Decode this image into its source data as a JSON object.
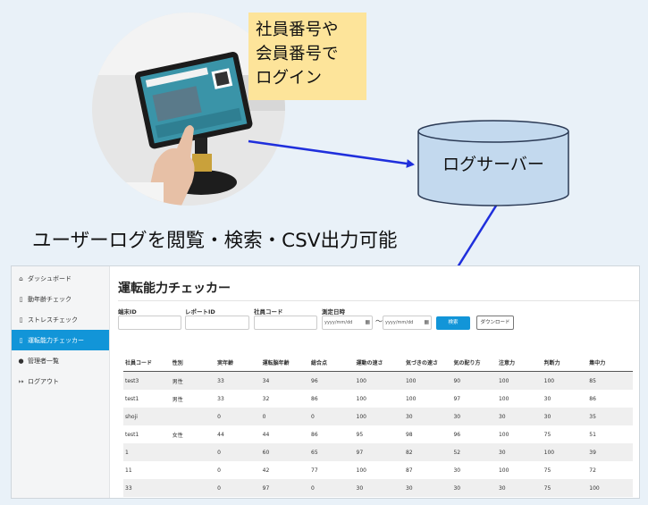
{
  "callout": {
    "lines": [
      "社員番号や",
      "会員番号で",
      "ログイン"
    ]
  },
  "server": {
    "label": "ログサーバー"
  },
  "headline": "ユーザーログを閲覧・検索・CSV出力可能",
  "app": {
    "sidebar": {
      "items": [
        {
          "icon": "home-icon",
          "label": "ダッシュボード",
          "active": false
        },
        {
          "icon": "document-icon",
          "label": "動年齢チェック",
          "active": false
        },
        {
          "icon": "document-icon",
          "label": "ストレスチェック",
          "active": false
        },
        {
          "icon": "document-icon",
          "label": "運転能力チェッカー",
          "active": true
        },
        {
          "icon": "user-icon",
          "label": "管理者一覧",
          "active": false
        },
        {
          "icon": "logout-icon",
          "label": "ログアウト",
          "active": false
        }
      ]
    },
    "page_title": "運転能力チェッカー",
    "filters": {
      "device_id_label": "端末ID",
      "report_id_label": "レポートID",
      "employee_code_label": "社員コード",
      "date_label": "測定日時",
      "date_from_placeholder": "yyyy/mm/dd",
      "date_to_placeholder": "yyyy/mm/dd",
      "tilde": "〜",
      "search_button": "検索",
      "download_button": "ダウンロード"
    },
    "table": {
      "headers": [
        "社員コード",
        "性別",
        "実年齢",
        "運転脳年齢",
        "総合点",
        "運動の速さ",
        "気づきの速さ",
        "気の配り方",
        "注意力",
        "判断力",
        "集中力"
      ],
      "rows": [
        [
          "test3",
          "男性",
          "33",
          "34",
          "96",
          "100",
          "100",
          "90",
          "100",
          "100",
          "85"
        ],
        [
          "test1",
          "男性",
          "33",
          "32",
          "86",
          "100",
          "100",
          "97",
          "100",
          "30",
          "86"
        ],
        [
          "shoji",
          "",
          "0",
          "0",
          "0",
          "100",
          "30",
          "30",
          "30",
          "30",
          "35"
        ],
        [
          "test1",
          "女性",
          "44",
          "44",
          "86",
          "95",
          "98",
          "96",
          "100",
          "75",
          "51"
        ],
        [
          "1",
          "",
          "0",
          "60",
          "65",
          "97",
          "82",
          "52",
          "30",
          "100",
          "39"
        ],
        [
          "11",
          "",
          "0",
          "42",
          "77",
          "100",
          "87",
          "30",
          "100",
          "75",
          "72"
        ],
        [
          "33",
          "",
          "0",
          "97",
          "0",
          "30",
          "30",
          "30",
          "30",
          "75",
          "100"
        ]
      ]
    }
  },
  "colors": {
    "accent": "#1295d8",
    "arrow": "#1f2fdc",
    "callout": "#fde49a",
    "cylinder": "#c3d9ee"
  }
}
